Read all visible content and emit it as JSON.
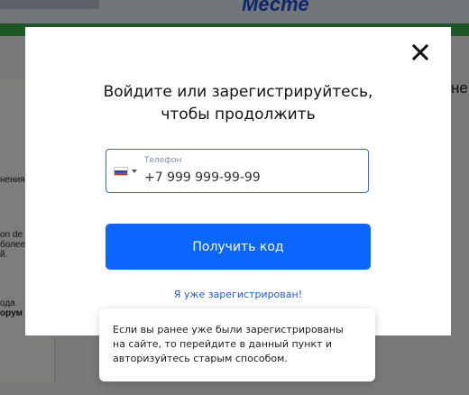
{
  "background": {
    "heading": "Месте",
    "left_snippets": [
      "нения",
      "on de",
      "более",
      "й.",
      "ода",
      "орум"
    ],
    "right_snippet": "не"
  },
  "modal": {
    "title_line1": "Войдите или зарегистрируйтесь,",
    "title_line2": "чтобы продолжить",
    "phone": {
      "label": "Телефон",
      "placeholder": "+7 999 999-99-99",
      "country": "RU"
    },
    "submit_label": "Получить код",
    "login_link": "Я уже зарегистрирован!",
    "tooltip": {
      "line1": "Если вы ранее уже были зарегистрированы",
      "line2": "на сайте, то перейдите в данный пункт и",
      "line3": "авторизуйтесь старым способом."
    },
    "icons": {
      "close": "close-icon",
      "flag": "russia-flag-icon",
      "caret": "chevron-down-icon"
    }
  },
  "colors": {
    "accent": "#0a66ff",
    "link": "#1f5ad6",
    "field_border": "#2d6be3",
    "green_bar": "#34b34a",
    "overlay": "rgba(0,0,0,0.5)"
  }
}
